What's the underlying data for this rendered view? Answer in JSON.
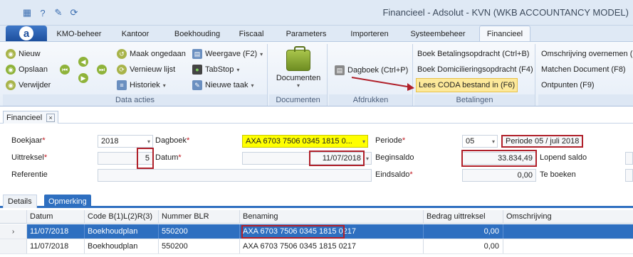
{
  "window": {
    "title": "Financieel - Adsolut - KVN (WKB ACCOUNTANCY MODEL)",
    "qat_icons": [
      "calculator-icon",
      "help-icon",
      "tools-icon",
      "refresh-icon"
    ]
  },
  "ribbon_tabs": [
    {
      "label": "KMO-beheer"
    },
    {
      "label": "Kantoor"
    },
    {
      "label": "Boekhouding"
    },
    {
      "label": "Fiscaal"
    },
    {
      "label": "Parameters"
    },
    {
      "label": "Importeren"
    },
    {
      "label": "Systeembeheer"
    },
    {
      "label": "Financieel",
      "active": true
    }
  ],
  "ribbon": {
    "data_acties": {
      "label": "Data acties",
      "nieuw": "Nieuw",
      "opslaan": "Opslaan",
      "verwijder": "Verwijder",
      "maak_ongedaan": "Maak ongedaan",
      "vernieuw_lijst": "Vernieuw lijst",
      "historiek": "Historiek",
      "weergave": "Weergave (F2)",
      "tabstop": "TabStop",
      "nieuwe_taak": "Nieuwe taak"
    },
    "documenten": {
      "label": "Documenten",
      "button": "Documenten"
    },
    "afdrukken": {
      "label": "Afdrukken",
      "dagboek": "Dagboek (Ctrl+P)"
    },
    "betalingen": {
      "label": "Betalingen",
      "boek_betalingsopdracht": "Boek Betalingsopdracht (Ctrl+B)",
      "boek_domicilieringsopdracht": "Boek Domicilieringsopdracht (F4)",
      "lees_coda": "Lees CODA bestand in (F6)"
    },
    "extra": {
      "omschrijving_overnemen": "Omschrijving overnemen (",
      "matchen_document": "Matchen Document (F8)",
      "ontpunten": "Ontpunten (F9)"
    }
  },
  "doc_tab": {
    "label": "Financieel",
    "close": "×"
  },
  "form": {
    "boekjaar_label": "Boekjaar",
    "boekjaar_value": "2018",
    "dagboek_label": "Dagboek",
    "dagboek_value": "AXA 6703 7506 0345 1815 0...",
    "periode_label": "Periode",
    "periode_value": "05",
    "periode_text": "Periode 05 / juli 2018",
    "uittreksel_label": "Uittreksel",
    "uittreksel_value": "5",
    "datum_label": "Datum",
    "datum_value": "11/07/2018",
    "beginsaldo_label": "Beginsaldo",
    "beginsaldo_value": "33.834,49",
    "lopend_saldo_label": "Lopend saldo",
    "referentie_label": "Referentie",
    "eindsaldo_label": "Eindsaldo",
    "eindsaldo_value": "0,00",
    "te_boeken_label": "Te boeken",
    "required_mark": "*"
  },
  "sub_tabs": [
    {
      "label": "Details"
    },
    {
      "label": "Opmerking",
      "active": true
    }
  ],
  "grid": {
    "columns": [
      "Datum",
      "Code B(1)L(2)R(3)",
      "Nummer BLR",
      "Benaming",
      "Bedrag uittreksel",
      "Omschrijving"
    ],
    "rows": [
      {
        "datum": "11/07/2018",
        "code": "Boekhoudplan",
        "nummer": "550200",
        "benaming": "AXA 6703 7506 0345 1815 0217",
        "bedrag": "0,00",
        "omschrijving": "",
        "selected": true
      },
      {
        "datum": "11/07/2018",
        "code": "Boekhoudplan",
        "nummer": "550200",
        "benaming": "AXA 6703 7506 0345 1815 0217",
        "bedrag": "0,00",
        "omschrijving": ""
      }
    ],
    "row_indicator": "›"
  },
  "colors": {
    "accent": "#2e6fc0",
    "highlight": "#fde99a",
    "annotation_red": "#b0202a",
    "dagboek_yellow": "#ffff00"
  }
}
